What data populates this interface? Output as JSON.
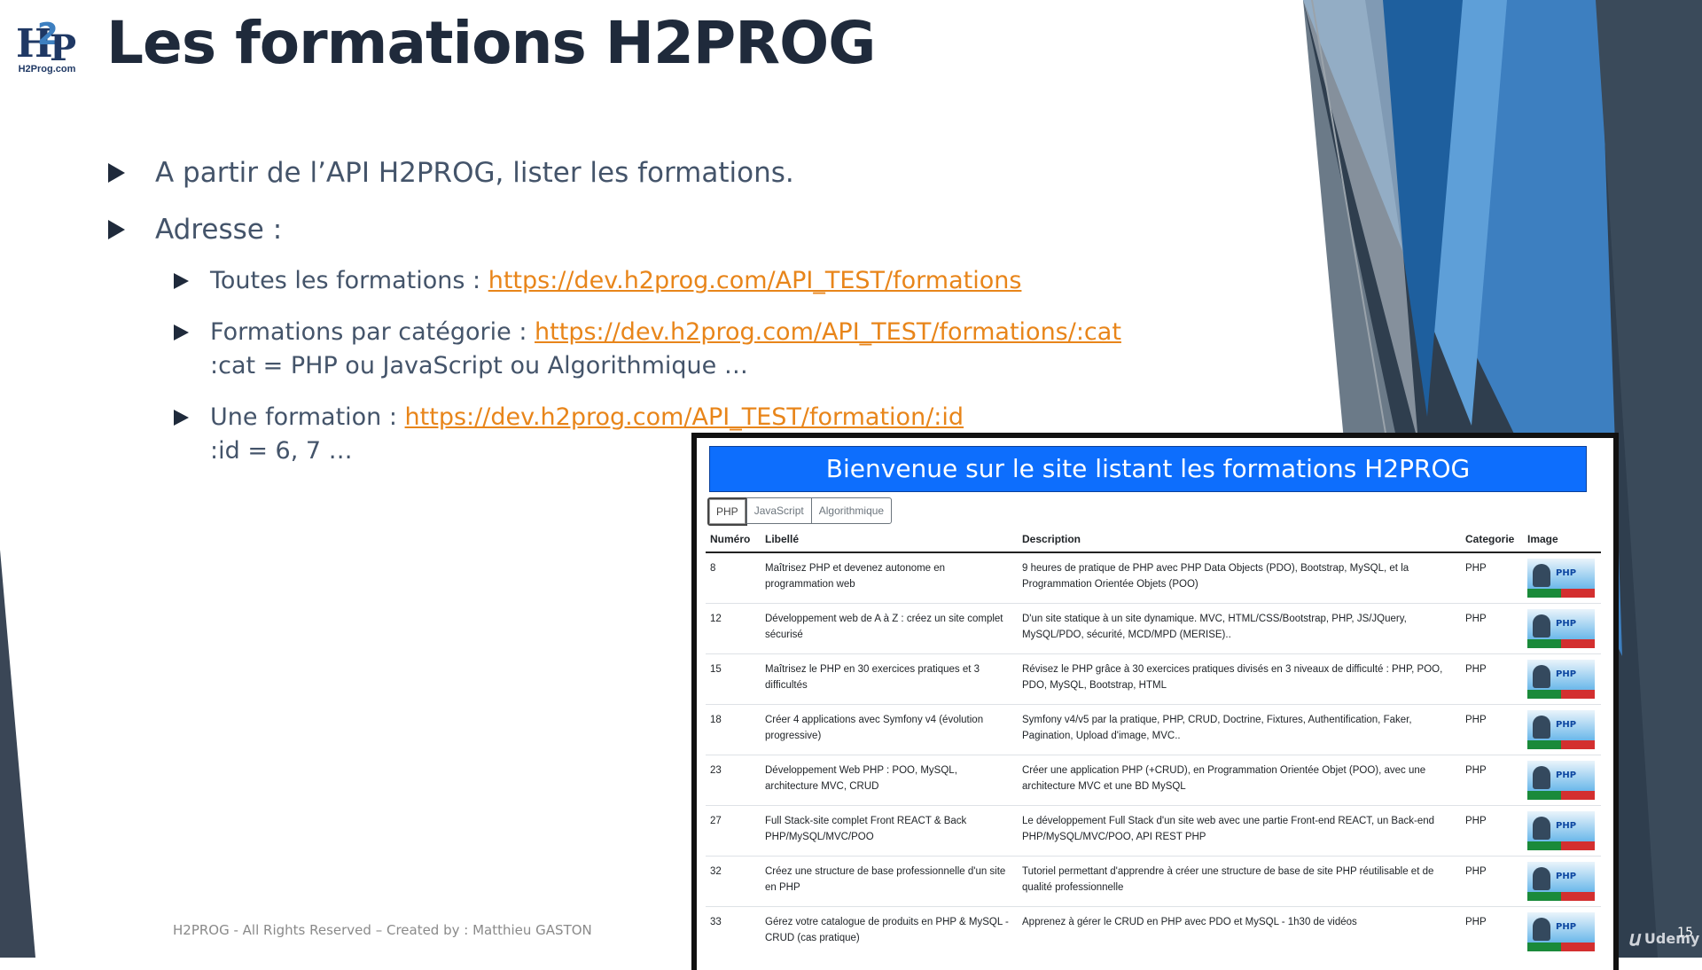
{
  "slide": {
    "logo_text": "H2Prog.com",
    "title": "Les formations H2PROG",
    "bullets": [
      "A partir de l’API H2PROG, lister les formations.",
      "Adresse :"
    ],
    "sub_bullets": [
      {
        "label": "Toutes les formations : ",
        "link": "https://dev.h2prog.com/API_TEST/formations",
        "note": ""
      },
      {
        "label": "Formations par catégorie : ",
        "link": "https://dev.h2prog.com/API_TEST/formations/:cat",
        "note": ":cat = PHP ou JavaScript ou Algorithmique …"
      },
      {
        "label": "Une formation : ",
        "link": "https://dev.h2prog.com/API_TEST/formation/:id",
        "note": ":id = 6, 7 …"
      }
    ],
    "footer": "H2PROG - All Rights Reserved – Created by : Matthieu GASTON",
    "page_number": "15",
    "watermark": "Udemy",
    "colors": {
      "title": "#1f2a3b",
      "link": "#e8851a",
      "banner": "#0d6efd"
    }
  },
  "site": {
    "banner_title": "Bienvenue sur le site listant les formations H2PROG",
    "tabs": [
      "PHP",
      "JavaScript",
      "Algorithmique"
    ],
    "active_tab": "PHP",
    "columns": [
      "Numéro",
      "Libellé",
      "Description",
      "Categorie",
      "Image"
    ],
    "rows": [
      {
        "num": "8",
        "libelle": "Maîtrisez PHP et devenez autonome en programmation web",
        "description": "9 heures de pratique de PHP avec PHP Data Objects (PDO), Bootstrap, MySQL, et la Programmation Orientée Objets (POO)",
        "categorie": "PHP",
        "img_text": "PHP"
      },
      {
        "num": "12",
        "libelle": "Développement web de A à Z : créez un site complet sécurisé",
        "description": "D'un site statique à un site dynamique. MVC, HTML/CSS/Bootstrap, PHP, JS/JQuery, MySQL/PDO, sécurité, MCD/MPD (MERISE)..",
        "categorie": "PHP",
        "img_text": "PHP"
      },
      {
        "num": "15",
        "libelle": "Maîtrisez le PHP en 30 exercices pratiques et 3 difficultés",
        "description": "Révisez le PHP grâce à 30 exercices pratiques divisés en 3 niveaux de difficulté : PHP, POO, PDO, MySQL, Bootstrap, HTML",
        "categorie": "PHP",
        "img_text": "PHP"
      },
      {
        "num": "18",
        "libelle": "Créer 4 applications avec Symfony v4 (évolution progressive)",
        "description": "Symfony v4/v5 par la pratique, PHP, CRUD, Doctrine, Fixtures, Authentification, Faker, Pagination, Upload d'image, MVC..",
        "categorie": "PHP",
        "img_text": "PHP"
      },
      {
        "num": "23",
        "libelle": "Développement Web PHP : POO, MySQL, architecture MVC, CRUD",
        "description": "Créer une application PHP (+CRUD), en Programmation Orientée Objet (POO), avec une architecture MVC et une BD MySQL",
        "categorie": "PHP",
        "img_text": "PHP"
      },
      {
        "num": "27",
        "libelle": "Full Stack-site complet Front REACT & Back PHP/MySQL/MVC/POO",
        "description": "Le développement Full Stack d'un site web avec une partie Front-end REACT, un Back-end PHP/MySQL/MVC/POO, API REST PHP",
        "categorie": "PHP",
        "img_text": "PHP"
      },
      {
        "num": "32",
        "libelle": "Créez une structure de base professionnelle d'un site en PHP",
        "description": "Tutoriel permettant d'apprendre à créer une structure de base de site PHP réutilisable et de qualité professionnelle",
        "categorie": "PHP",
        "img_text": "PHP"
      },
      {
        "num": "33",
        "libelle": "Gérez votre catalogue de produits en PHP & MySQL - CRUD (cas pratique)",
        "description": "Apprenez à gérer le CRUD en PHP avec PDO et MySQL - 1h30 de vidéos",
        "categorie": "PHP",
        "img_text": "PHP"
      }
    ]
  }
}
